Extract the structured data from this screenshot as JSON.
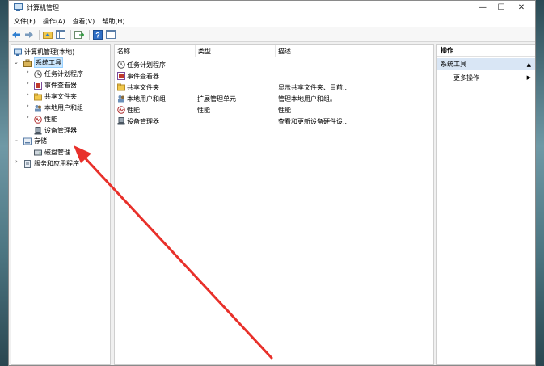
{
  "window": {
    "title": "计算机管理"
  },
  "window_controls": {
    "minimize": "—",
    "maximize": "☐",
    "close": "✕"
  },
  "menu": [
    "文件(F)",
    "操作(A)",
    "查看(V)",
    "帮助(H)"
  ],
  "tree": {
    "root": "计算机管理(本地)",
    "system_tools": "系统工具",
    "system_children": [
      "任务计划程序",
      "事件查看器",
      "共享文件夹",
      "本地用户和组",
      "性能",
      "设备管理器"
    ],
    "storage": "存储",
    "storage_children": [
      "磁盘管理"
    ],
    "services": "服务和应用程序"
  },
  "columns": {
    "name": "名称",
    "type": "类型",
    "desc": "描述"
  },
  "rows": [
    {
      "name": "任务计划程序",
      "type": "",
      "desc": "",
      "icon": "clock-icon"
    },
    {
      "name": "事件查看器",
      "type": "",
      "desc": "",
      "icon": "event-viewer-icon"
    },
    {
      "name": "共享文件夹",
      "type": "",
      "desc": "显示共享文件夹、目前...",
      "icon": "shared-folder-icon"
    },
    {
      "name": "本地用户和组",
      "type": "扩展管理单元",
      "desc": "管理本地用户和组。",
      "icon": "users-icon"
    },
    {
      "name": "性能",
      "type": "性能",
      "desc": "性能",
      "icon": "performance-icon"
    },
    {
      "name": "设备管理器",
      "type": "",
      "desc": "查看和更新设备硬件设...",
      "icon": "device-manager-icon"
    }
  ],
  "actions": {
    "header": "操作",
    "group": "系统工具",
    "group_chevron": "▲",
    "item": "更多操作",
    "item_chevron": "▶"
  },
  "colors": {
    "annotation_arrow": "#e8302a",
    "selection": "#cce8ff",
    "actions_group": "#d9e6f5"
  }
}
